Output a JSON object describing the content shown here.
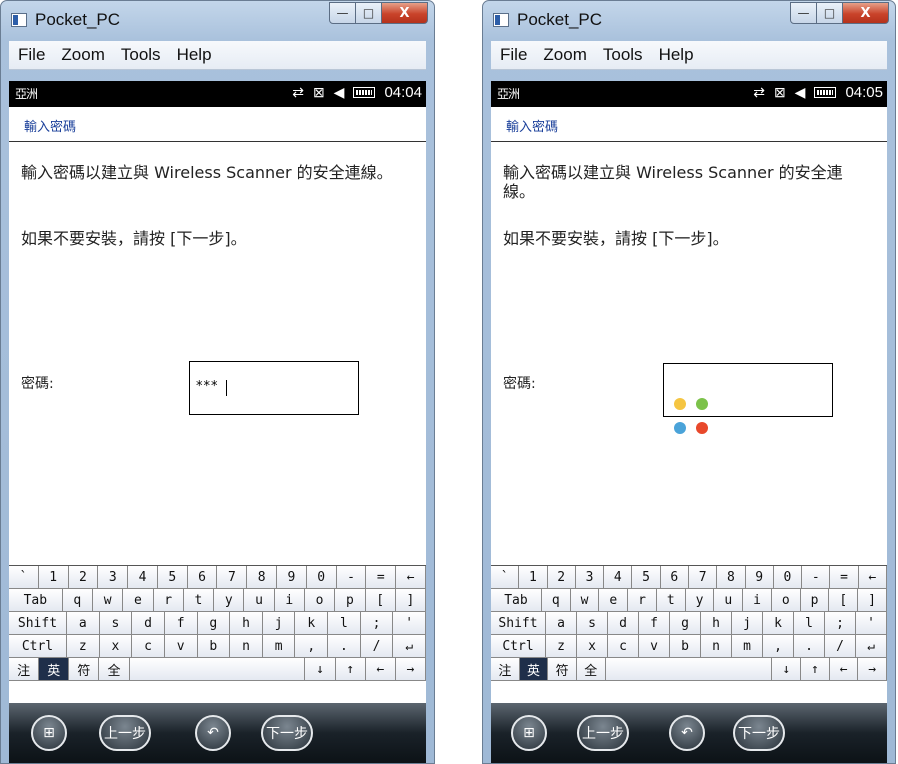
{
  "windows": [
    {
      "title": "Pocket_PC",
      "menu": [
        "File",
        "Zoom",
        "Tools",
        "Help"
      ],
      "status": {
        "left": "亞洲",
        "time": "04:04"
      },
      "page_title": "輸入密碼",
      "text1": "輸入密碼以建立與 Wireless Scanner 的安全連線。",
      "text2": "如果不要安裝，請按 [下一步]。",
      "password_label": "密碼:",
      "password_value": "***",
      "soft_keys": {
        "start": "⊞",
        "back": "上一步",
        "undo": "↶",
        "next": "下一步"
      }
    },
    {
      "title": "Pocket_PC",
      "menu": [
        "File",
        "Zoom",
        "Tools",
        "Help"
      ],
      "status": {
        "left": "亞洲",
        "time": "04:05"
      },
      "page_title": "輸入密碼",
      "text1": "輸入密碼以建立與 Wireless Scanner 的安全連線。",
      "text2": "如果不要安裝，請按 [下一步]。",
      "password_label": "密碼:",
      "password_value": "",
      "soft_keys": {
        "start": "⊞",
        "back": "上一步",
        "undo": "↶",
        "next": "下一步"
      }
    }
  ],
  "keyboard": {
    "row1": [
      "`",
      "1",
      "2",
      "3",
      "4",
      "5",
      "6",
      "7",
      "8",
      "9",
      "0",
      "-",
      "=",
      "←"
    ],
    "row2": [
      "Tab",
      "q",
      "w",
      "e",
      "r",
      "t",
      "y",
      "u",
      "i",
      "o",
      "p",
      "[",
      "]"
    ],
    "row3": [
      "Shift",
      "a",
      "s",
      "d",
      "f",
      "g",
      "h",
      "j",
      "k",
      "l",
      ";",
      "'"
    ],
    "row4": [
      "Ctrl",
      "z",
      "x",
      "c",
      "v",
      "b",
      "n",
      "m",
      ",",
      ".",
      "/",
      "↵"
    ],
    "row5": [
      "注",
      "英",
      "符",
      "全",
      "",
      "↓",
      "↑",
      "←",
      "→"
    ]
  },
  "caption_buttons": {
    "minimize": "—",
    "maximize": "□",
    "close": "X"
  },
  "colors": {
    "title_blue": "#1a3f9a",
    "status_bg": "#000000",
    "spinner": [
      "#f5c542",
      "#7cc24a",
      "#4aa3d9",
      "#e8482b"
    ]
  }
}
